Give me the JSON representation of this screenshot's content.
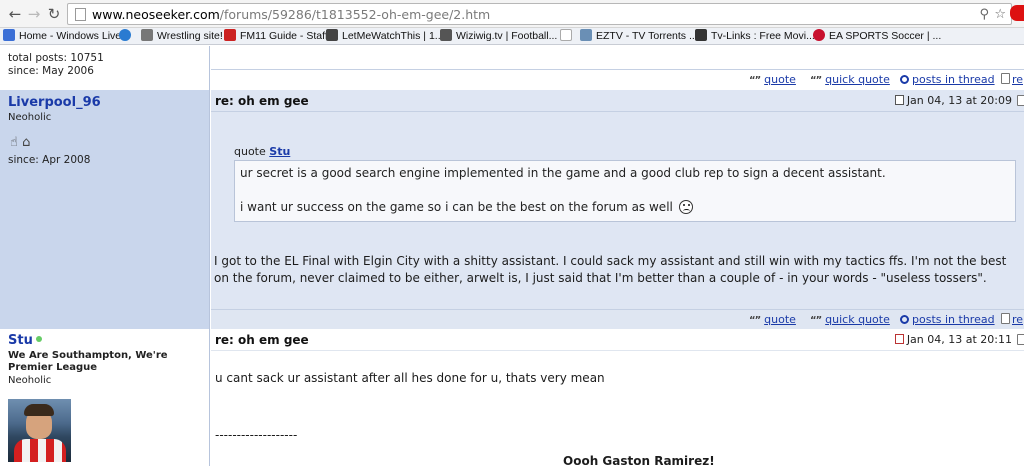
{
  "browser": {
    "url_host": "www.neoseeker.com",
    "url_path": "/forums/59286/t1813552-oh-em-gee/2.htm",
    "bookmarks": [
      {
        "label": "Home - Windows Live",
        "color": "#3b6fd6"
      },
      {
        "label": "",
        "color": "#2a7bd1"
      },
      {
        "label": "Wrestling site!",
        "color": "#777777"
      },
      {
        "label": "FM11 Guide - Staff",
        "color": "#cc2222"
      },
      {
        "label": "LetMeWatchThis | 1...",
        "color": "#444444"
      },
      {
        "label": "Wiziwig.tv | Football...",
        "color": "#555555"
      },
      {
        "label": "",
        "color": "#aaaaaa"
      },
      {
        "label": "EZTV - TV Torrents ...",
        "color": "#6a8fb5"
      },
      {
        "label": "Tv-Links : Free Movi...",
        "color": "#333333"
      },
      {
        "label": "EA SPORTS Soccer | ...",
        "color": "#c8102e"
      }
    ]
  },
  "prev_post": {
    "total_posts": "total posts: 10751",
    "since": "since: May 2006"
  },
  "actions": {
    "quote_label": "quote",
    "quick_quote_label": "quick quote",
    "posts_in_thread_label": "posts in thread",
    "report_label": "repo"
  },
  "post1": {
    "username": "Liverpool_96",
    "rank": "Neoholic",
    "since": "since: Apr 2008",
    "title": "re: oh em gee",
    "date": "Jan 04, 13 at 20:09",
    "quote_prefix": "quote",
    "quote_author": "Stu",
    "quote_line1": "ur secret is a good search engine implemented in the game and a good club rep to sign a decent assistant.",
    "quote_line2": "i want ur success on the game so i can be the best on the forum as well",
    "body": "I got to the EL Final with Elgin City with a shitty assistant. I could sack my assistant and still win with my tactics ffs. I'm not the best on the forum, never claimed to be either, arwelt is, I just said that I'm better than a couple of - in your words - \"useless tossers\"."
  },
  "post2": {
    "username": "Stu",
    "user_title": "We Are Southampton, We're Premier League",
    "rank": "Neoholic",
    "title": "re: oh em gee",
    "date": "Jan 04, 13 at 20:11",
    "body": "u cant sack ur assistant after all hes done for u, thats very mean",
    "separator": "-------------------",
    "signature": "Oooh Gaston Ramirez!"
  }
}
